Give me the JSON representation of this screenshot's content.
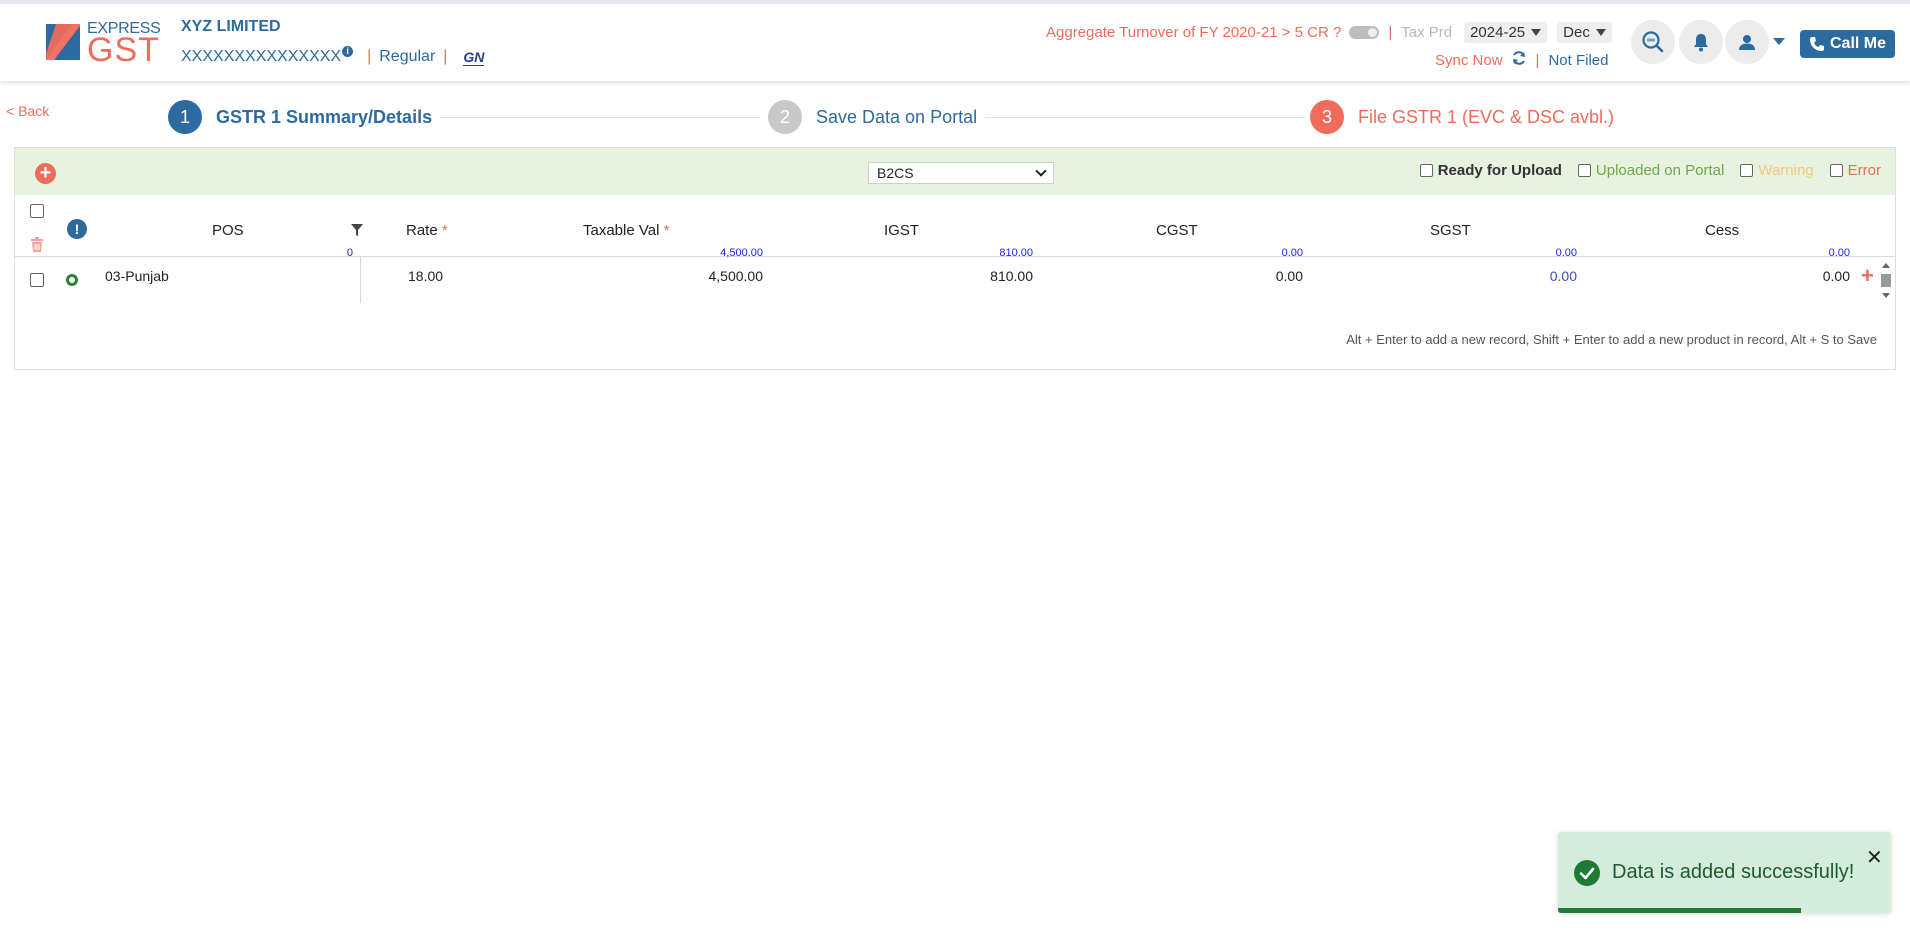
{
  "header": {
    "logo_top": "EXPRESS",
    "logo_main": "GST",
    "company_name": "XYZ LIMITED",
    "gstin": "XXXXXXXXXXXXXXX",
    "gstin_info_icon": "i",
    "registration_type": "Regular",
    "gstn_logo_text": "GN",
    "turnover_label": "Aggregate Turnover of FY 2020-21 > 5 CR ?",
    "tax_period_label": "Tax Prd",
    "financial_year": "2024-25",
    "month": "Dec",
    "sync_label": "Sync Now",
    "filing_status": "Not Filed",
    "call_label": "Call Me"
  },
  "nav": {
    "back_label": "< Back"
  },
  "steps": [
    {
      "num": "1",
      "label": "GSTR 1 Summary/Details"
    },
    {
      "num": "2",
      "label": "Save Data on Portal"
    },
    {
      "num": "3",
      "label": "File GSTR 1 (EVC & DSC avbl.)"
    }
  ],
  "toolbar": {
    "add_symbol": "+",
    "section_select": "B2CS",
    "filters": {
      "ready": "Ready for Upload",
      "uploaded": "Uploaded on Portal",
      "warning": "Warning",
      "error": "Error"
    }
  },
  "table": {
    "status_header_symbol": "!",
    "columns": {
      "pos": "POS",
      "rate": "Rate",
      "taxable": "Taxable Val",
      "igst": "IGST",
      "cgst": "CGST",
      "sgst": "SGST",
      "cess": "Cess"
    },
    "required_mark": "*",
    "totals": {
      "pos_count": "0",
      "taxable": "4,500.00",
      "igst": "810.00",
      "cgst": "0.00",
      "sgst": "0.00",
      "cess": "0.00"
    },
    "rows": [
      {
        "pos": "03-Punjab",
        "rate": "18.00",
        "taxable": "4,500.00",
        "igst": "810.00",
        "cgst": "0.00",
        "sgst": "0.00",
        "cess": "0.00"
      }
    ],
    "add_row_symbol": "+"
  },
  "hint": "Alt + Enter to add a new record, Shift + Enter to add a new product in record, Alt + S to Save",
  "toast": {
    "message": "Data is added successfully!",
    "close_symbol": "✕",
    "progress": 0.73
  },
  "colors": {
    "brand_blue": "#2d6a9f",
    "accent_coral": "#ef6b5b",
    "success_green": "#1e7a34",
    "toolbar_bg": "#e7f3df"
  }
}
